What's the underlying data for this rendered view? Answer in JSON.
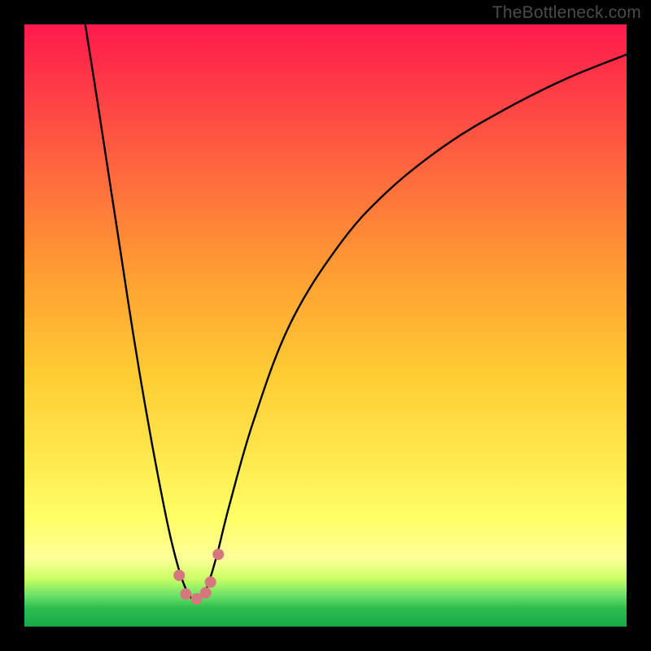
{
  "watermark": {
    "text": "TheBottleneck.com"
  },
  "colors": {
    "page_bg": "#000000",
    "curve_stroke": "#000000",
    "marker_fill": "#d6777f",
    "gradient_stops": [
      "#ff1a4d",
      "#ff3347",
      "#ff6040",
      "#ff9933",
      "#ffcc33",
      "#ffe84d",
      "#ffff66",
      "#ffff99",
      "#ccff66",
      "#66e066",
      "#2dbd4e",
      "#17a84a"
    ]
  },
  "chart_data": {
    "type": "line",
    "title": "",
    "xlabel": "",
    "ylabel": "",
    "xlim": [
      0,
      100
    ],
    "ylim": [
      0,
      100
    ],
    "grid": false,
    "legend": false,
    "series": [
      {
        "name": "curve",
        "x": [
          10.1,
          12,
          14,
          16,
          18,
          20,
          22,
          24,
          25.5,
          26.5,
          27.5,
          28.5,
          29.5,
          30.5,
          32,
          34,
          38,
          44,
          52,
          60,
          70,
          80,
          90,
          100
        ],
        "y": [
          100,
          88,
          75,
          62,
          49,
          37,
          26,
          16,
          10,
          7,
          5,
          4.5,
          5,
          7,
          12,
          20,
          34,
          50,
          63,
          72,
          80,
          86,
          91,
          95
        ]
      }
    ],
    "markers": [
      {
        "x": 25.7,
        "y": 8.5
      },
      {
        "x": 26.8,
        "y": 5.4
      },
      {
        "x": 28.6,
        "y": 4.6
      },
      {
        "x": 30.1,
        "y": 5.6
      },
      {
        "x": 30.9,
        "y": 7.4
      },
      {
        "x": 32.2,
        "y": 12.0
      }
    ]
  }
}
